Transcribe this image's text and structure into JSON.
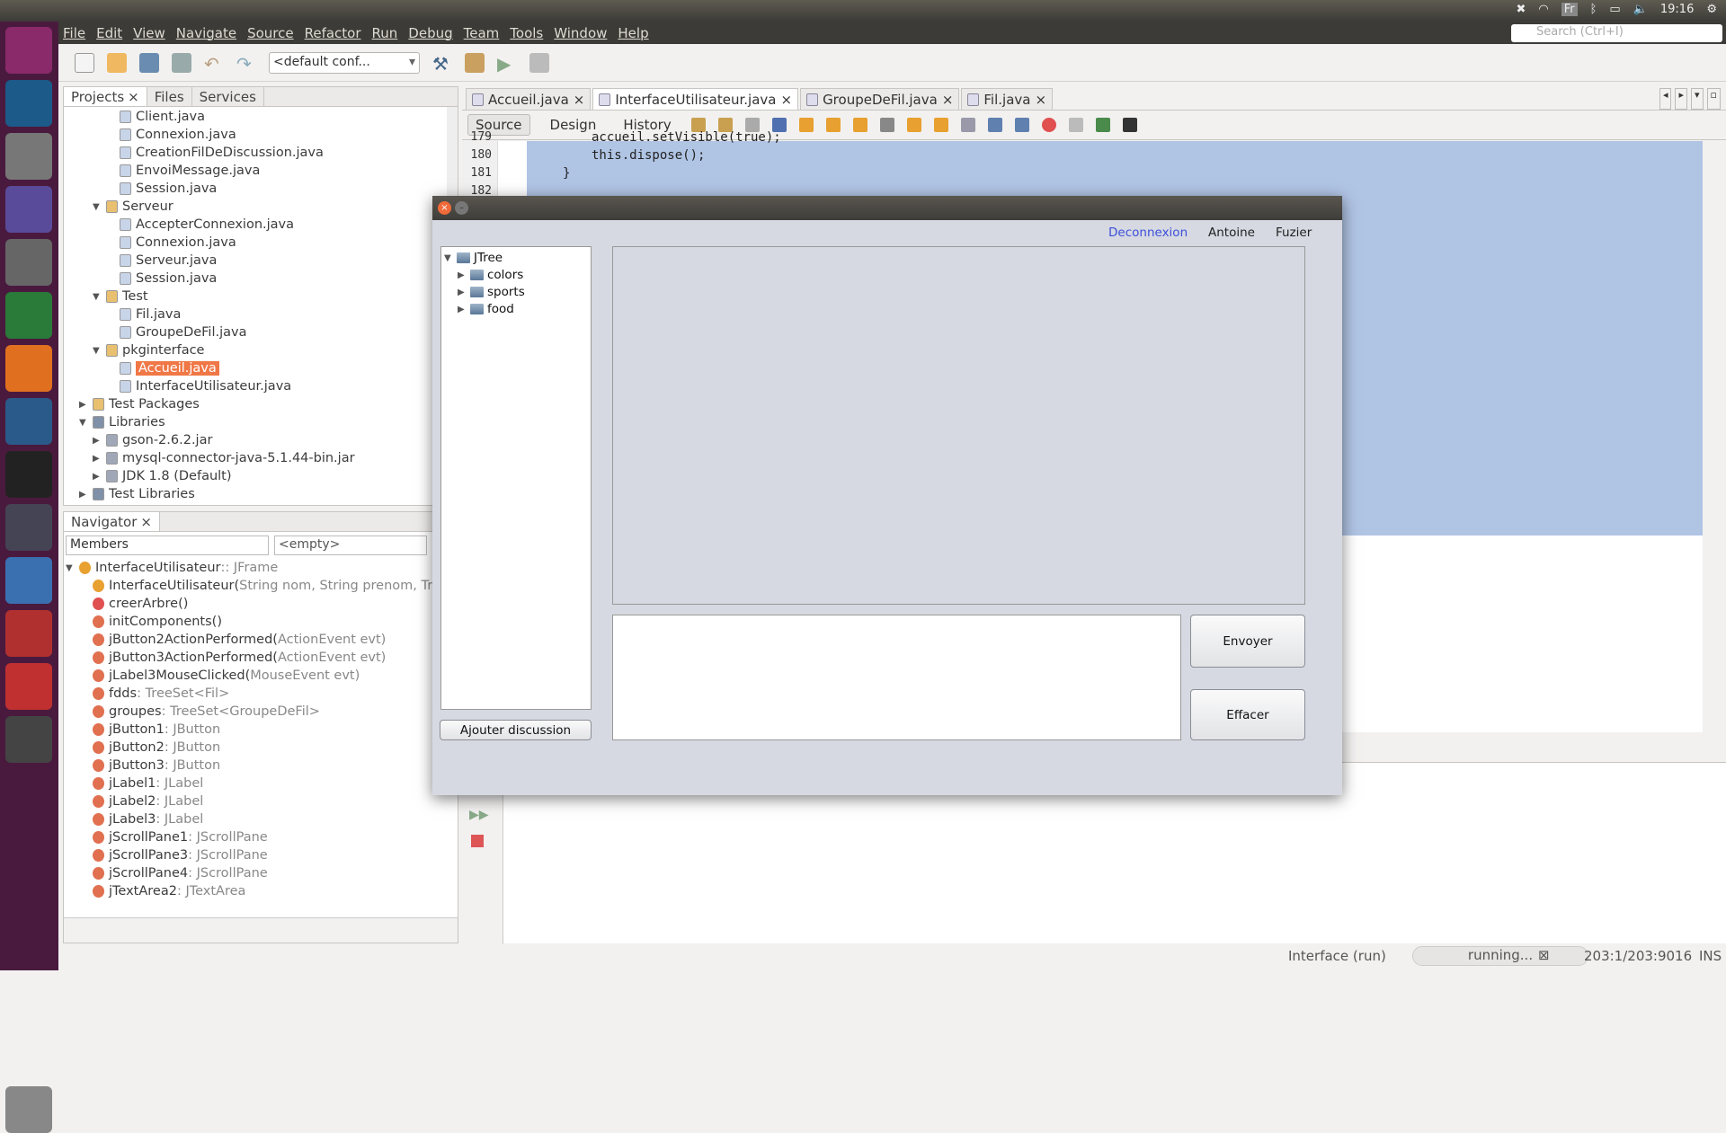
{
  "topbar": {
    "keyboard": "Fr",
    "time": "19:16"
  },
  "launcher": {
    "items": [
      "ubuntu-dash",
      "wireshark",
      "files",
      "eclipse",
      "system-settings",
      "chrome",
      "vlc",
      "mysql-workbench",
      "terminal",
      "sublime",
      "virtualbox",
      "network",
      "evince",
      "java",
      "trash"
    ]
  },
  "menu": [
    "File",
    "Edit",
    "View",
    "Navigate",
    "Source",
    "Refactor",
    "Run",
    "Debug",
    "Team",
    "Tools",
    "Window",
    "Help"
  ],
  "search_placeholder": "Search (Ctrl+I)",
  "toolbar": {
    "config": "<default conf..."
  },
  "projects": {
    "tabs": [
      "Projects",
      "Files",
      "Services"
    ],
    "rows": [
      {
        "t": "Client.java",
        "d": 3,
        "i": "java"
      },
      {
        "t": "Connexion.java",
        "d": 3,
        "i": "java"
      },
      {
        "t": "CreationFilDeDiscussion.java",
        "d": 3,
        "i": "java"
      },
      {
        "t": "EnvoiMessage.java",
        "d": 3,
        "i": "java"
      },
      {
        "t": "Session.java",
        "d": 3,
        "i": "java"
      },
      {
        "t": "Serveur",
        "d": 2,
        "i": "pkg",
        "o": 1
      },
      {
        "t": "AccepterConnexion.java",
        "d": 3,
        "i": "java"
      },
      {
        "t": "Connexion.java",
        "d": 3,
        "i": "java"
      },
      {
        "t": "Serveur.java",
        "d": 3,
        "i": "java"
      },
      {
        "t": "Session.java",
        "d": 3,
        "i": "java"
      },
      {
        "t": "Test",
        "d": 2,
        "i": "pkg",
        "o": 1
      },
      {
        "t": "Fil.java",
        "d": 3,
        "i": "java"
      },
      {
        "t": "GroupeDeFil.java",
        "d": 3,
        "i": "java"
      },
      {
        "t": "pkginterface",
        "d": 2,
        "i": "pkg",
        "o": 1
      },
      {
        "t": "Accueil.java",
        "d": 3,
        "i": "java",
        "s": 1
      },
      {
        "t": "InterfaceUtilisateur.java",
        "d": 3,
        "i": "java"
      },
      {
        "t": "Test Packages",
        "d": 1,
        "i": "pkg",
        "o": 0
      },
      {
        "t": "Libraries",
        "d": 1,
        "i": "lib",
        "o": 1
      },
      {
        "t": "gson-2.6.2.jar",
        "d": 2,
        "i": "jar",
        "o": 0
      },
      {
        "t": "mysql-connector-java-5.1.44-bin.jar",
        "d": 2,
        "i": "jar",
        "o": 0
      },
      {
        "t": "JDK 1.8 (Default)",
        "d": 2,
        "i": "jar",
        "o": 0
      },
      {
        "t": "Test Libraries",
        "d": 1,
        "i": "lib",
        "o": 0
      }
    ]
  },
  "navigator": {
    "tab": "Navigator",
    "filter": "Members",
    "filter2": "<empty>",
    "rows": [
      {
        "t": "InterfaceUtilisateur",
        "g": " :: JFrame",
        "d": 0,
        "o": 1
      },
      {
        "t": "InterfaceUtilisateur(",
        "g": "String nom, String prenom, Tre",
        "d": 1,
        "c": "#e8a030"
      },
      {
        "t": "creerArbre()",
        "g": "",
        "d": 1,
        "c": "#e05050"
      },
      {
        "t": "initComponents()",
        "g": "",
        "d": 1,
        "c": "#e07050"
      },
      {
        "t": "jButton2ActionPerformed(",
        "g": "ActionEvent evt)",
        "d": 1,
        "c": "#e07050"
      },
      {
        "t": "jButton3ActionPerformed(",
        "g": "ActionEvent evt)",
        "d": 1,
        "c": "#e07050"
      },
      {
        "t": "jLabel3MouseClicked(",
        "g": "MouseEvent evt)",
        "d": 1,
        "c": "#e07050"
      },
      {
        "t": "fdds",
        "g": " : TreeSet<Fil>",
        "d": 1,
        "c": "#e07050"
      },
      {
        "t": "groupes",
        "g": " : TreeSet<GroupeDeFil>",
        "d": 1,
        "c": "#e07050"
      },
      {
        "t": "jButton1",
        "g": " : JButton",
        "d": 1,
        "c": "#e07050"
      },
      {
        "t": "jButton2",
        "g": " : JButton",
        "d": 1,
        "c": "#e07050"
      },
      {
        "t": "jButton3",
        "g": " : JButton",
        "d": 1,
        "c": "#e07050"
      },
      {
        "t": "jLabel1",
        "g": " : JLabel",
        "d": 1,
        "c": "#e07050"
      },
      {
        "t": "jLabel2",
        "g": " : JLabel",
        "d": 1,
        "c": "#e07050"
      },
      {
        "t": "jLabel3",
        "g": " : JLabel",
        "d": 1,
        "c": "#e07050"
      },
      {
        "t": "jScrollPane1",
        "g": " : JScrollPane",
        "d": 1,
        "c": "#e07050"
      },
      {
        "t": "jScrollPane3",
        "g": " : JScrollPane",
        "d": 1,
        "c": "#e07050"
      },
      {
        "t": "jScrollPane4",
        "g": " : JScrollPane",
        "d": 1,
        "c": "#e07050"
      },
      {
        "t": "jTextArea2",
        "g": " : JTextArea",
        "d": 1,
        "c": "#e07050"
      }
    ]
  },
  "editor": {
    "tabs": [
      "Accueil.java",
      "InterfaceUtilisateur.java",
      "GroupeDeFil.java",
      "Fil.java"
    ],
    "active": 1,
    "views": [
      "Source",
      "Design",
      "History"
    ],
    "lines": [
      {
        "n": "179",
        "c": "accueil.setVisible(true);"
      },
      {
        "n": "180",
        "c": "this.dispose();"
      },
      {
        "n": "181",
        "c": "}"
      },
      {
        "n": "182",
        "c": ""
      }
    ]
  },
  "status": {
    "task": "Interface (run)",
    "progress": "running...",
    "position": "203:1/203:9016",
    "mode": "INS"
  },
  "dialog": {
    "deconnexion": "Deconnexion",
    "prenom": "Antoine",
    "nom": "Fuzier",
    "tree": {
      "root": "JTree",
      "children": [
        "colors",
        "sports",
        "food"
      ]
    },
    "add_button": "Ajouter discussion",
    "send_button": "Envoyer",
    "clear_button": "Effacer",
    "message_input": ""
  },
  "colors": {
    "selection": "#f07746",
    "link": "#3c4fd8",
    "code_selection": "#b0c4e4"
  }
}
